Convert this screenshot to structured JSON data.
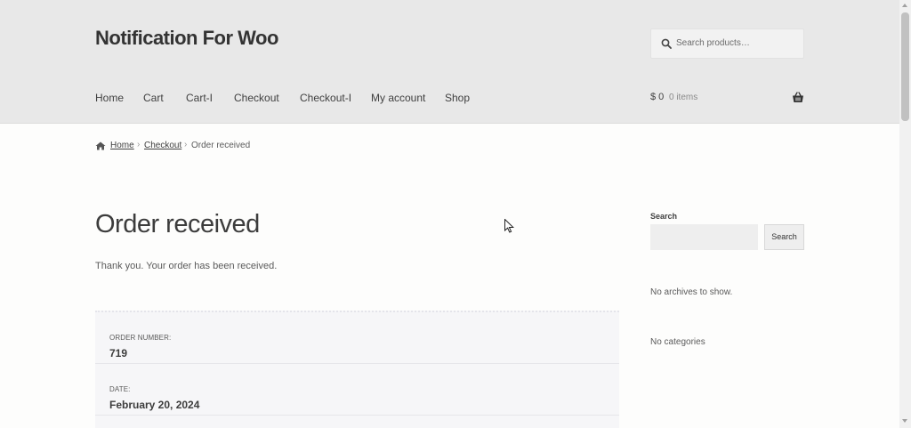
{
  "site": {
    "title": "Notification For Woo"
  },
  "header_search": {
    "placeholder": "Search products…",
    "icon": "search-icon"
  },
  "nav": {
    "items": [
      {
        "label": "Home"
      },
      {
        "label": "Cart"
      },
      {
        "label": "Cart-I"
      },
      {
        "label": "Checkout"
      },
      {
        "label": "Checkout-I"
      },
      {
        "label": "My account"
      },
      {
        "label": "Shop"
      }
    ]
  },
  "cart": {
    "amount": "$ 0",
    "count": "0 items",
    "icon": "basket-icon"
  },
  "breadcrumb": {
    "home": "Home",
    "checkout": "Checkout",
    "current": "Order received",
    "separator": "›"
  },
  "main": {
    "title": "Order received",
    "message": "Thank you. Your order has been received.",
    "order_details": [
      {
        "label": "ORDER NUMBER:",
        "value": "719"
      },
      {
        "label": "DATE:",
        "value": "February 20, 2024"
      }
    ]
  },
  "sidebar": {
    "search_label": "Search",
    "search_button": "Search",
    "archives_text": "No archives to show.",
    "categories_text": "No categories"
  },
  "colors": {
    "header_bg": "#e8e8e8",
    "page_bg": "#fdfdfc",
    "order_box_bg": "#f6f6f8",
    "text": "#43454b"
  }
}
